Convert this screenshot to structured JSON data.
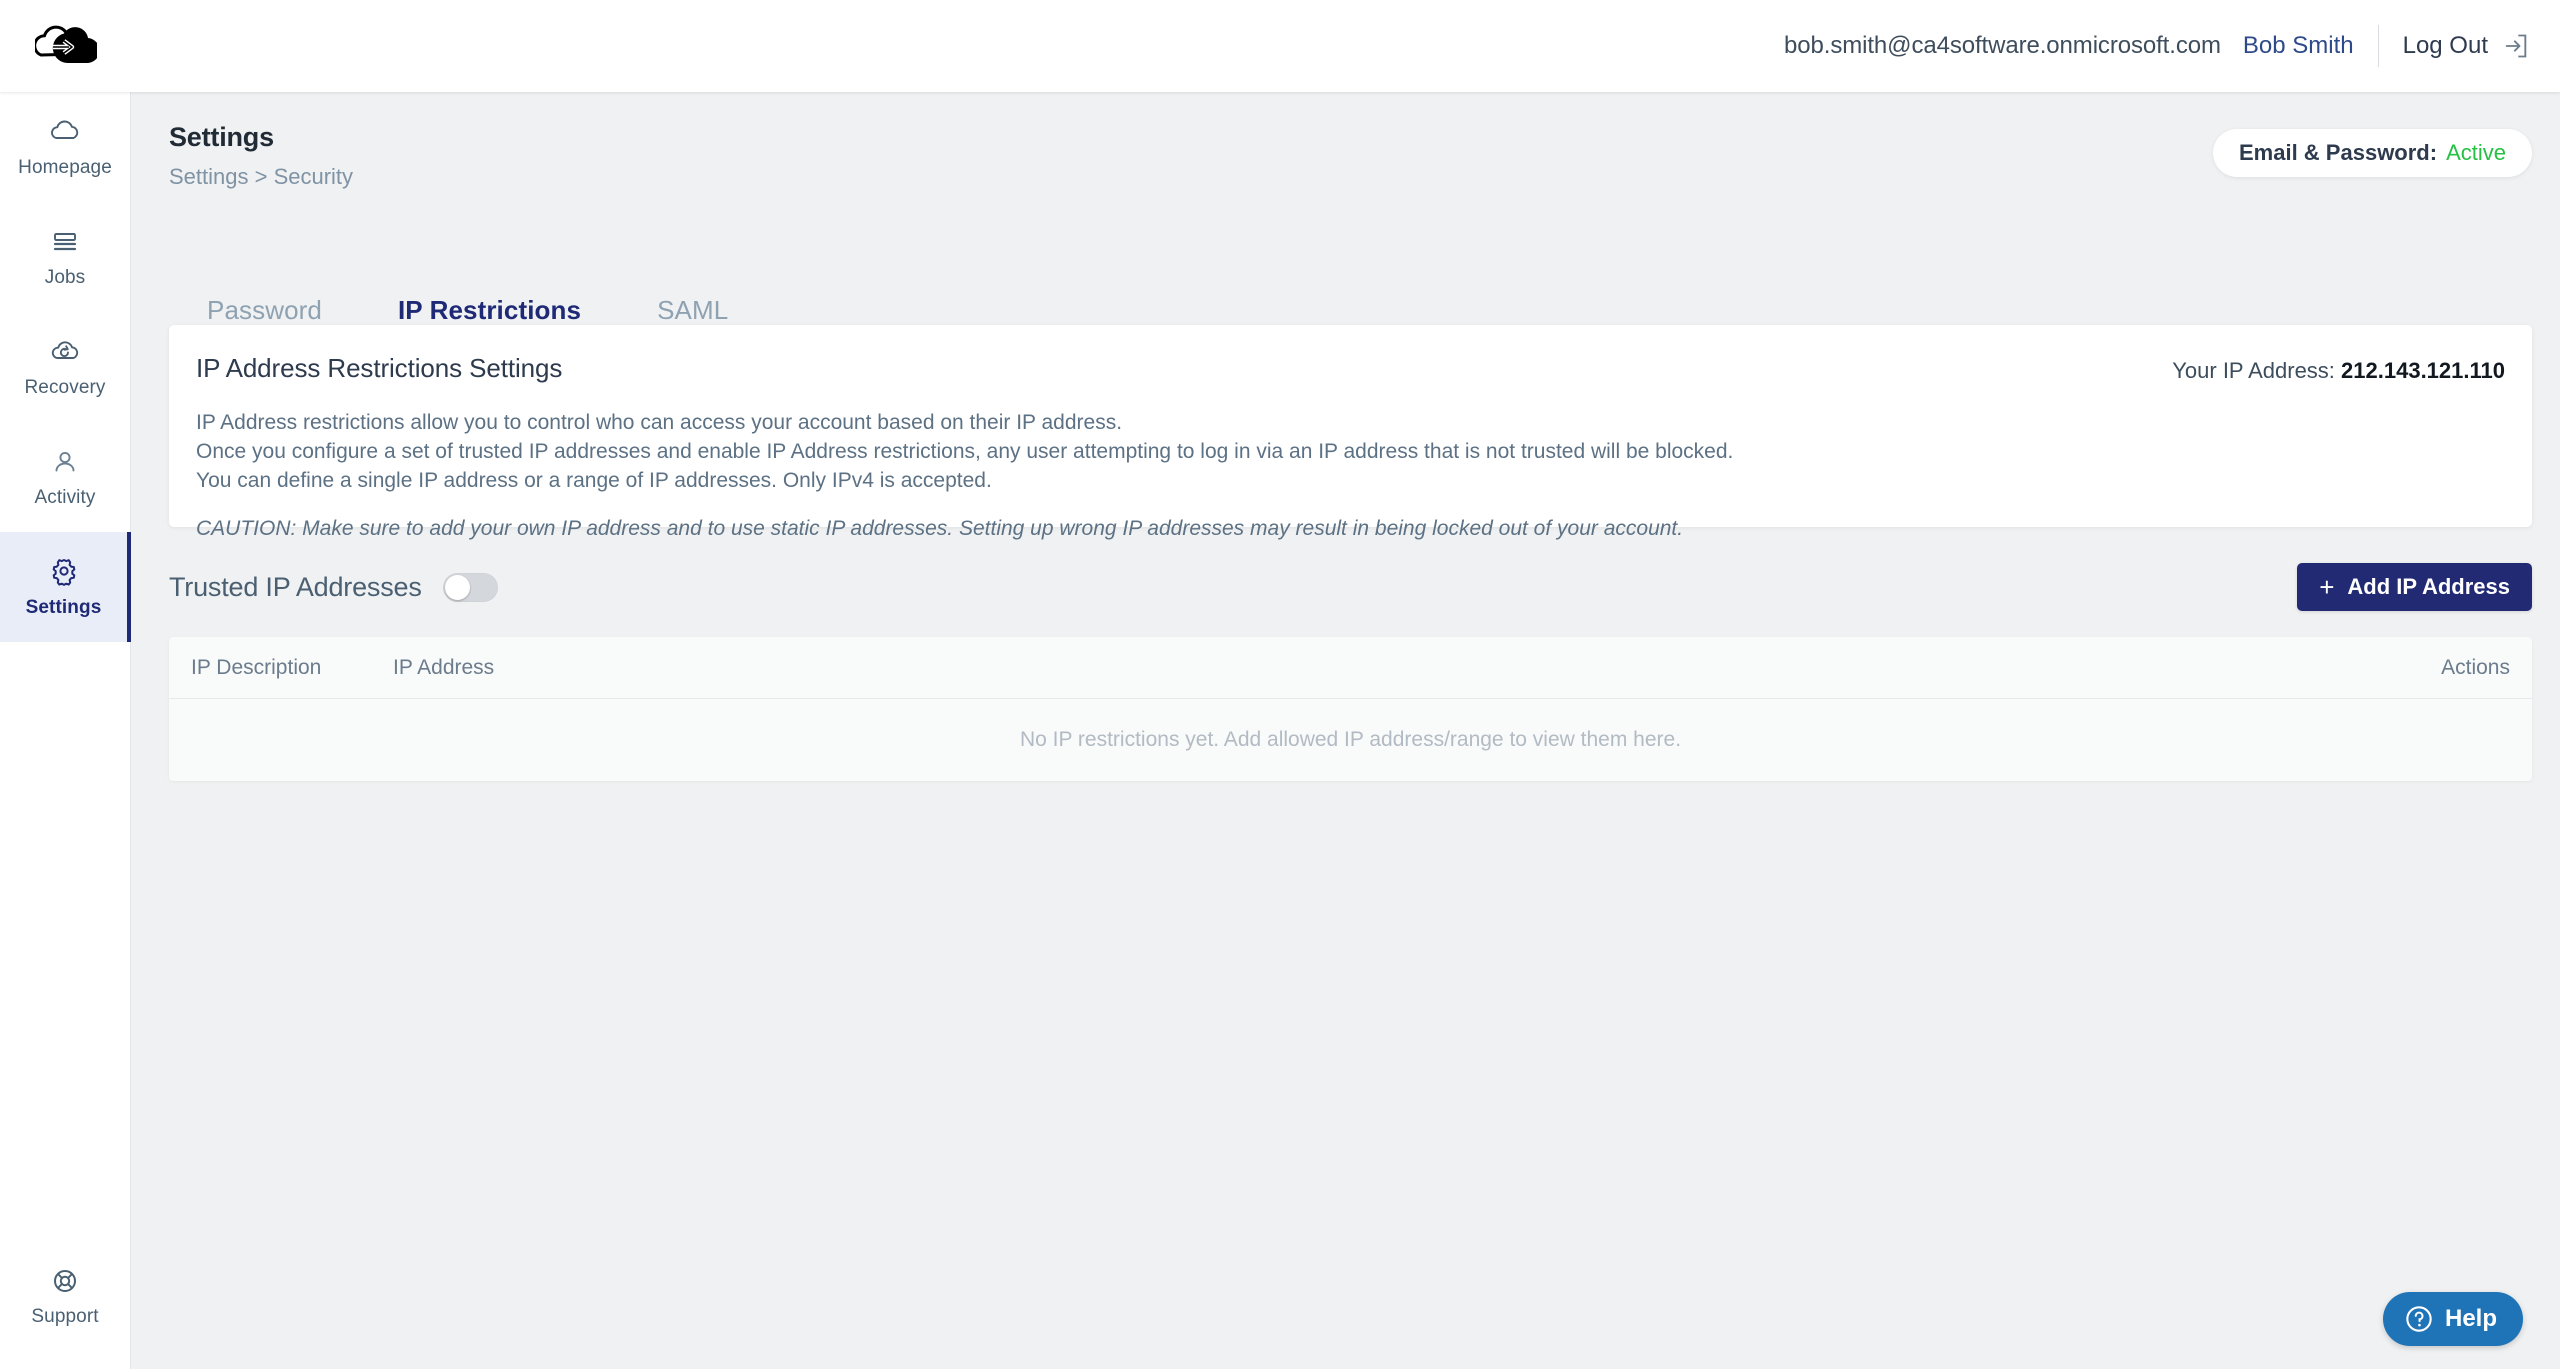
{
  "topbar": {
    "logo_icon": "cloud-migration-logo",
    "email": "bob.smith@ca4software.onmicrosoft.com",
    "user_name": "Bob Smith",
    "logout_label": "Log Out",
    "logout_icon": "logout-arrow-icon"
  },
  "sidebar": {
    "items": [
      {
        "label": "Homepage",
        "icon": "cloud-icon",
        "active": false
      },
      {
        "label": "Jobs",
        "icon": "stack-list-icon",
        "active": false
      },
      {
        "label": "Recovery",
        "icon": "cloud-refresh-icon",
        "active": false
      },
      {
        "label": "Activity",
        "icon": "user-icon",
        "active": false
      },
      {
        "label": "Settings",
        "icon": "gear-icon",
        "active": true
      }
    ],
    "bottom": {
      "label": "Support",
      "icon": "lifebuoy-icon"
    }
  },
  "page": {
    "title": "Settings",
    "breadcrumb": "Settings > Security"
  },
  "status_pill": {
    "label": "Email & Password:",
    "value": "Active",
    "value_color": "#26c045"
  },
  "tabs": [
    {
      "label": "Password",
      "active": false
    },
    {
      "label": "IP Restrictions",
      "active": true
    },
    {
      "label": "SAML",
      "active": false
    }
  ],
  "card": {
    "title": "IP Address Restrictions Settings",
    "ip_label": "Your IP Address:",
    "ip_value": "212.143.121.110",
    "paragraphs": [
      "IP Address restrictions allow you to control who can access your account based on their IP address.",
      "Once you configure a set of trusted IP addresses and enable IP Address restrictions, any user attempting to log in via an IP address that is not trusted will be blocked.",
      "You can define a single IP address or a range of IP addresses. Only IPv4 is accepted."
    ],
    "caution": "CAUTION: Make sure to add your own IP address and to use static IP addresses. Setting up wrong IP addresses may result in being locked out of your account."
  },
  "trusted": {
    "title": "Trusted IP Addresses",
    "toggle_state": "off",
    "add_button": {
      "label": "Add IP Address",
      "plus": "+",
      "color": "#222a74"
    }
  },
  "table": {
    "columns": [
      "IP Description",
      "IP Address",
      "Actions"
    ],
    "rows": [],
    "empty_message": "No IP restrictions yet. Add allowed IP address/range to view them here."
  },
  "help_widget": {
    "label": "Help",
    "icon": "question-circle-icon",
    "color": "#1f73b7"
  }
}
